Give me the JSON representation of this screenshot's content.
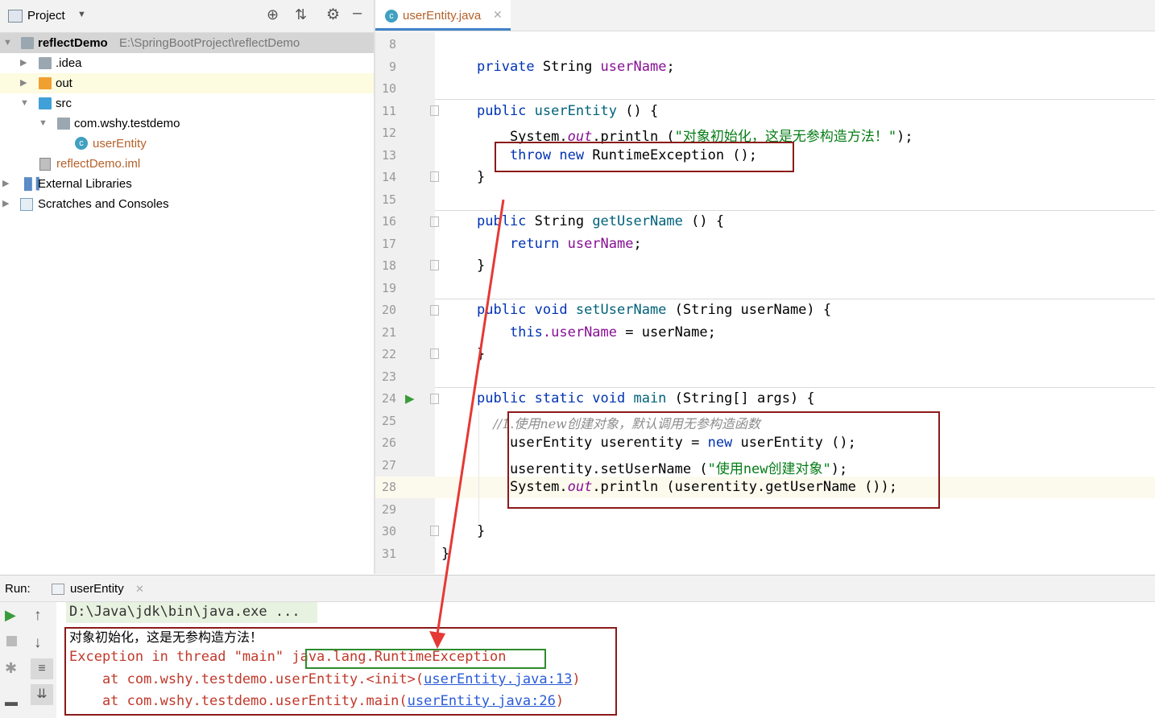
{
  "project_panel": {
    "title": "Project",
    "tree": [
      {
        "label": "reflectDemo",
        "path": "E:\\SpringBootProject\\reflectDemo",
        "expanded": true
      },
      {
        "label": ".idea"
      },
      {
        "label": "out"
      },
      {
        "label": "src"
      },
      {
        "label": "com.wshy.testdemo"
      },
      {
        "label": "userEntity"
      },
      {
        "label": "reflectDemo.iml"
      },
      {
        "label": "External Libraries"
      },
      {
        "label": "Scratches and Consoles"
      }
    ]
  },
  "editor": {
    "tab_label": "userEntity.java",
    "line_numbers": [
      "8",
      "9",
      "10",
      "11",
      "12",
      "13",
      "14",
      "15",
      "16",
      "17",
      "18",
      "19",
      "20",
      "21",
      "22",
      "23",
      "24",
      "25",
      "26",
      "27",
      "28",
      "29",
      "30",
      "31"
    ],
    "code": {
      "l9_kw": "private",
      "l9_type": " String ",
      "l9_field": "userName",
      "l9_end": ";",
      "l11_kw": "public",
      "l11_fn": " userEntity",
      "l11_end": " () {",
      "l12_a": "    System.",
      "l12_out": "out",
      "l12_b": ".println (",
      "l12_str": "\"对象初始化，这是无参构造方法！\"",
      "l12_end": ");",
      "l13_kw1": "    throw",
      "l13_kw2": " new",
      "l13_rest": " RuntimeException ();",
      "l14": "}",
      "l16_kw": "public",
      "l16_type": " String ",
      "l16_fn": "getUserName",
      "l16_end": " () {",
      "l17_kw": "    return",
      "l17_fld": " userName",
      "l17_end": ";",
      "l18": "}",
      "l20_kw": "public void",
      "l20_fn": " setUserName",
      "l20_end": " (String userName) {",
      "l21_kw": "    this",
      "l21_fld": ".userName",
      "l21_end": " = userName;",
      "l22": "}",
      "l24_kw": "public static void",
      "l24_fn": " main",
      "l24_end": " (String[] args) {",
      "l25_cmt": "    //1.使用new创建对象，默认调用无参构造函数",
      "l26_a": "    userEntity userentity = ",
      "l26_kw": "new",
      "l26_b": " userEntity ();",
      "l27_a": "    userentity.setUserName (",
      "l27_str": "\"使用new创建对象\"",
      "l27_end": ");",
      "l28_a": "    System.",
      "l28_out": "out",
      "l28_b": ".println (userentity.getUserName ());",
      "l30": "}",
      "l31": "}"
    }
  },
  "run_panel": {
    "label": "Run:",
    "tab_label": "userEntity",
    "console": {
      "cmd": "D:\\Java\\jdk\\bin\\java.exe ...",
      "out1": "对象初始化，这是无参构造方法！",
      "exc_prefix": "Exception in thread \"main\" ",
      "exc_class": "java.lang.RuntimeException",
      "at1_prefix": "    at com.wshy.testdemo.userEntity.<init>(",
      "at1_link": "userEntity.java:13",
      "at1_suffix": ")",
      "at2_prefix": "    at com.wshy.testdemo.userEntity.main(",
      "at2_link": "userEntity.java:26",
      "at2_suffix": ")"
    }
  },
  "colors": {
    "keyword": "#0033b3",
    "field": "#871094",
    "string": "#067d17",
    "annotation_red": "#8b1a1a",
    "annotation_green": "#2e8b2e",
    "arrow": "#e53935"
  },
  "icons": [
    "project-view-icon",
    "dropdown-icon",
    "locate-icon",
    "collapse-icon",
    "gear-icon",
    "minimize-icon",
    "java-class-icon",
    "close-icon",
    "run-icon",
    "stop-icon",
    "up-arrow-icon",
    "down-arrow-icon",
    "soft-wrap-icon",
    "scroll-to-end-icon",
    "debug-icon",
    "layout-icon"
  ]
}
